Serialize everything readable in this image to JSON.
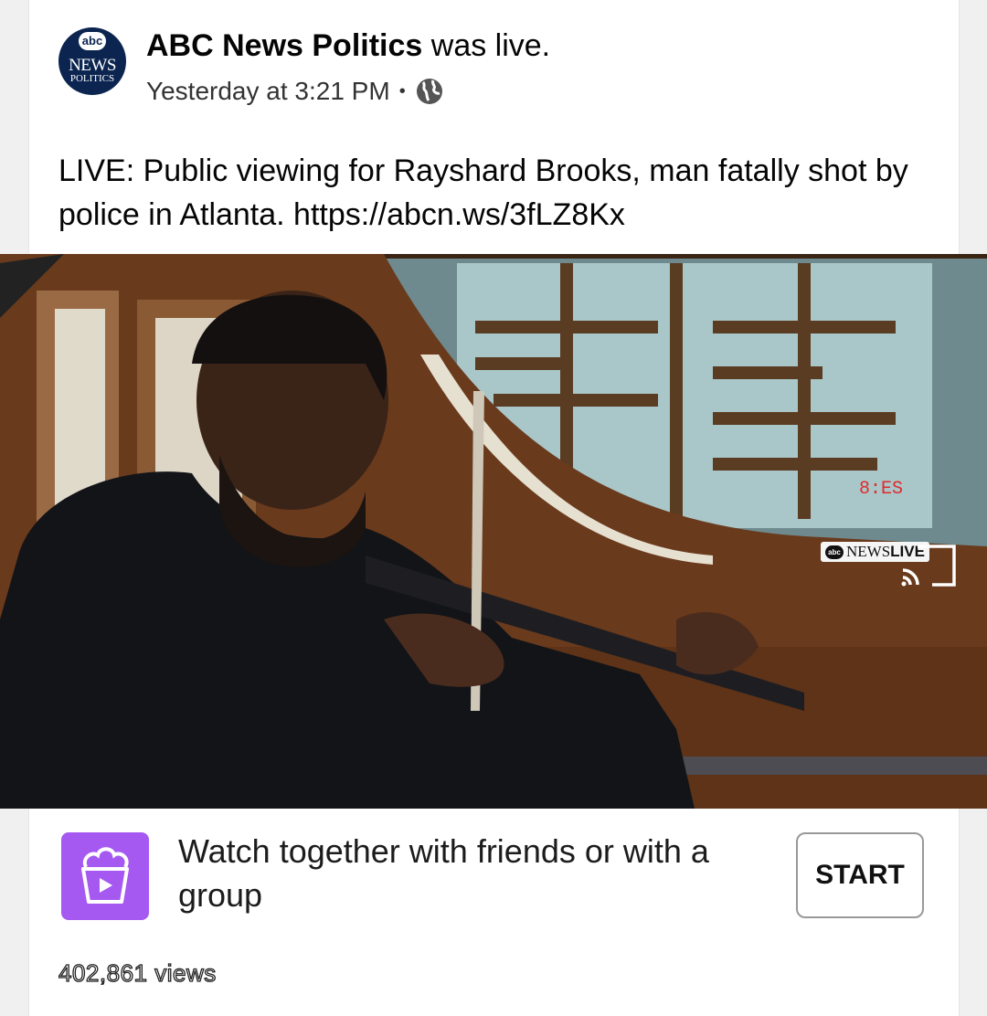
{
  "post": {
    "page_name": "ABC News Politics",
    "action": " was live.",
    "timestamp": "Yesterday at 3:21 PM",
    "separator": "•",
    "text": "LIVE: Public viewing for Rayshard Brooks, man fatally shot by police in Atlanta. https://abcn.ws/3fLZ8Kx",
    "avatar": {
      "logo_text": "abc",
      "line1": "NEWS",
      "line2": "POLITICS"
    },
    "privacy_icon": "globe-icon"
  },
  "video": {
    "badge_logo": "abc",
    "badge_news": "NEWS",
    "badge_live": "LIVE",
    "cast_icon": "cast-icon",
    "mute_icon": "speaker-muted-icon"
  },
  "watch_party": {
    "label": "Watch together with friends or with a group",
    "button_label": "START",
    "icon": "popcorn-play-icon",
    "accent_color": "#a659f1"
  },
  "stats": {
    "views": "402,861 views"
  }
}
